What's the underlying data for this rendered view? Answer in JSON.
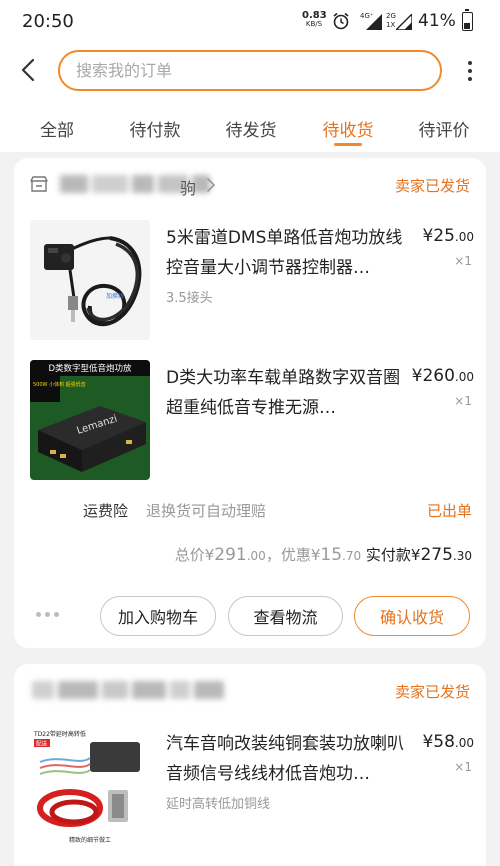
{
  "status_bar": {
    "time": "20:50",
    "net_speed": "0.83",
    "net_unit": "KB/S",
    "sim1_tag": "4G⁺",
    "sim2_tag": "2G",
    "sim2_sub": "1X",
    "battery_pct": "41%",
    "battery_level": 0.41
  },
  "search": {
    "placeholder": "搜索我的订单"
  },
  "tabs": [
    {
      "label": "全部",
      "active": false
    },
    {
      "label": "待付款",
      "active": false
    },
    {
      "label": "待发货",
      "active": false
    },
    {
      "label": "待收货",
      "active": true
    },
    {
      "label": "待评价",
      "active": false
    }
  ],
  "colors": {
    "accent": "#f08a2c",
    "accent_text": "#e6721b",
    "muted": "#999999"
  },
  "orders": [
    {
      "shop_name_tail": "驹",
      "status": "卖家已发货",
      "items": [
        {
          "title": "5米雷道DMS单路低音炮功放线控音量大小调节器控制器…",
          "spec": "3.5接头",
          "price": "25",
          "price_dec": ".00",
          "qty": "×1",
          "image_label": "加换线"
        },
        {
          "title": "D类大功率车载单路数字双音圈超重纯低音专推无源…",
          "spec": "",
          "price": "260",
          "price_dec": ".00",
          "qty": "×1",
          "image_banner": "D类数字型低音炮功放",
          "image_side": "500W 小体积 超强低音",
          "image_brand": "Lemanzi"
        }
      ],
      "insurance_label": "运费险",
      "insurance_desc": "退换货可自动理赔",
      "insurance_status": "已出单",
      "total_label": "总价",
      "total_int": "291",
      "total_dec": ".00",
      "discount_label": "，优惠",
      "discount_int": "15",
      "discount_dec": ".70",
      "paid_label": "实付款",
      "paid_int": "275",
      "paid_dec": ".30",
      "actions": {
        "add_cart": "加入购物车",
        "logistics": "查看物流",
        "confirm": "确认收货"
      }
    },
    {
      "status": "卖家已发货",
      "items": [
        {
          "title": "汽车音响改装纯铜套装功放喇叭音频信号线线材低音炮功…",
          "spec": "延时高转低加铜线",
          "price": "58",
          "price_dec": ".00",
          "qty": "×1",
          "image_label": "TD22带延时高转低",
          "image_tag": "配送",
          "image_caption": "精致的细节做工"
        }
      ]
    }
  ]
}
